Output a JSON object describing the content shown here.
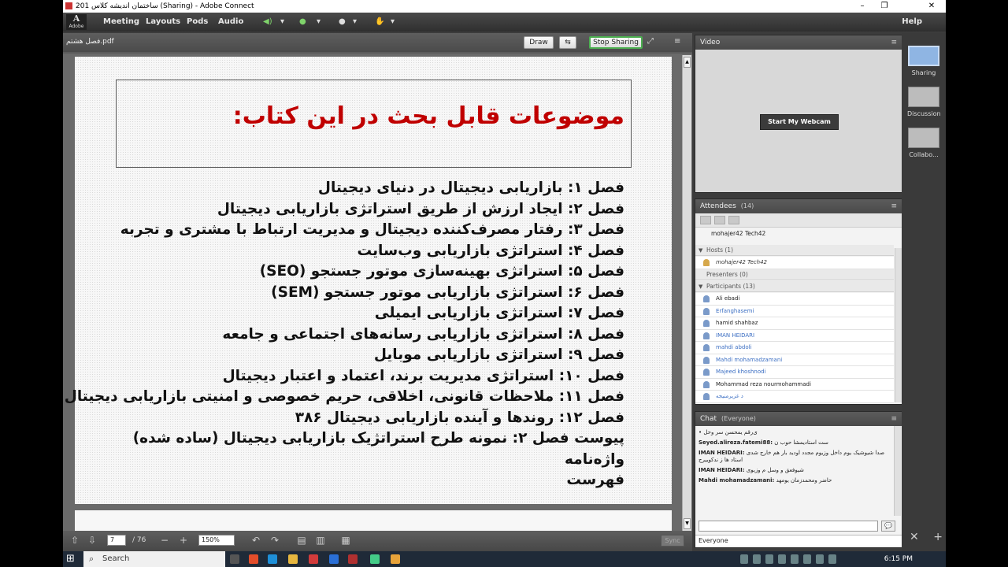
{
  "window": {
    "title": "ساختمان اندیشه کلاس 201 (Sharing) - Adobe Connect",
    "minimize": "–",
    "maximize": "❐",
    "close": "✕"
  },
  "menubar": {
    "logo_text": "Adobe",
    "logo_glyph": "A",
    "items": [
      "Meeting",
      "Layouts",
      "Pods",
      "Audio"
    ],
    "help": "Help"
  },
  "share_pod": {
    "filename": "فصل هشتم.pdf",
    "draw_label": "Draw",
    "stop_sharing_label": "Stop Sharing"
  },
  "slide": {
    "title": "موضوعات قابل بحث در این کتاب:",
    "chapters": [
      "فصل ۱: بازاریابی دیجیتال در دنیای دیجیتال",
      "فصل ۲: ایجاد ارزش از طریق استراتژی بازاریابی دیجیتال",
      "فصل ۳: رفتار مصرف‌کننده دیجیتال و مدیریت ارتباط با مشتری و تجربه",
      "فصل ۴: استراتژی بازاریابی وب‌سایت",
      "فصل ۵: استراتژی بهینه‌سازی موتور جستجو (SEO)",
      "فصل ۶: استراتژی بازاریابی موتور جستجو (SEM)",
      "فصل ۷: استراتژی بازاریابی ایمیلی",
      "فصل ۸: استراتژی بازاریابی رسانه‌های اجتماعی و جامعه",
      "فصل ۹: استراتژی بازاریابی موبایل",
      "فصل ۱۰: استراتژی مدیریت برند، اعتماد و اعتبار دیجیتال",
      "فصل ۱۱: ملاحظات قانونی، اخلاقی، حریم خصوصی و امنیتی بازاریابی دیجیتال",
      "فصل ۱۲: روندها و آینده بازاریابی دیجیتال ۳۸۶",
      "پیوست فصل ۲: نمونه طرح استراتژیک بازاریابی دیجیتال (ساده شده)",
      "واژه‌نامه",
      "فهرست"
    ]
  },
  "navigation": {
    "current_page": "7",
    "total_pages": "/ 76",
    "zoom": "150%",
    "sync_label": "Sync"
  },
  "video_pod": {
    "title": "Video",
    "webcam_button": "Start My Webcam"
  },
  "attendees_pod": {
    "title": "Attendees",
    "count": "(14)",
    "current_user": "mohajer42 Tech42",
    "hosts_group": "Hosts (1)",
    "hosts": [
      "mohajer42 Tech42"
    ],
    "presenters_group": "Presenters (0)",
    "participants_group": "Participants (13)",
    "participants": [
      "Ali ebadi",
      "Erfanghasemi",
      "hamid shahbaz",
      "IMAN HEIDARI",
      "mahdi abdoli",
      "Mahdi mohamadzamani",
      "Majeed khoshnodi",
      "Mohammad reza nourmohammadi",
      "د غزیرمنیجه"
    ]
  },
  "chat_pod": {
    "title": "Chat",
    "scope": "(Everyone)",
    "messages": [
      {
        "sender": "",
        "text": "• ی‌رقم یمحسن سر وحل"
      },
      {
        "sender": "Seyed.alireza.fatemi88:",
        "text": "ست استادیمشا حوب ن"
      },
      {
        "sender": "IMAN HEIDARI:",
        "text": "صدا شیوشیک یوم داخل وزیوم مجدد اودید بار هم خارج شدی استاد ها ز ندکوییرج"
      },
      {
        "sender": "IMAN HEIDARI:",
        "text": "شیوفعق و وسل م وزیوی"
      },
      {
        "sender": "Mahdi mohamadzamani:",
        "text": "حاضر ومحمدزمان یومهد"
      }
    ],
    "recipient": "Everyone"
  },
  "layouts": [
    {
      "label": "Sharing"
    },
    {
      "label": "Discussion"
    },
    {
      "label": "Collabo..."
    }
  ],
  "taskbar": {
    "search_placeholder": "Search",
    "time": "6:15 PM"
  }
}
